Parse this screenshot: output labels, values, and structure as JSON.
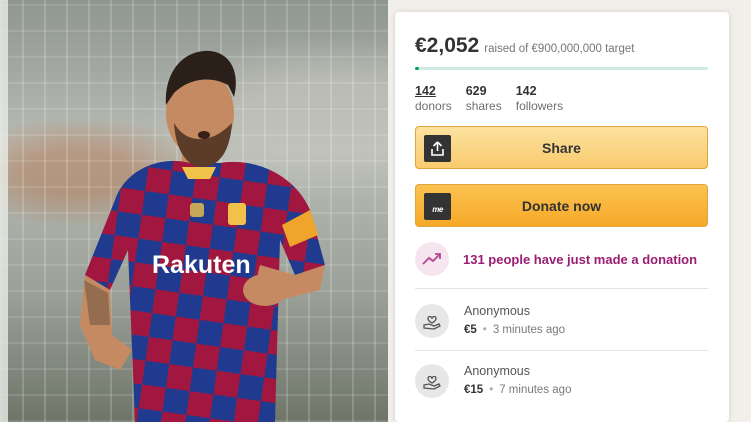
{
  "photo": {
    "alt": "Football player in a red and blue striped kit",
    "sponsor_text": "Rakuten"
  },
  "fundraiser": {
    "raised": "€2,052",
    "target_caption": "raised of €900,000,000 target",
    "progress_fraction": 0.002,
    "stats": [
      {
        "value": "142",
        "label": "donors"
      },
      {
        "value": "629",
        "label": "shares"
      },
      {
        "value": "142",
        "label": "followers"
      }
    ]
  },
  "buttons": {
    "share_label": "Share",
    "donate_label": "Donate now",
    "donate_icon_text": "me"
  },
  "activity": {
    "text": "131 people have just made a donation"
  },
  "donations": [
    {
      "name": "Anonymous",
      "amount": "€5",
      "time": "3 minutes ago"
    },
    {
      "name": "Anonymous",
      "amount": "€15",
      "time": "7 minutes ago"
    }
  ],
  "colors": {
    "progress": "#02a95c",
    "share_button": "#f9cb6e",
    "donate_button": "#f6a928",
    "activity_text": "#9b1d73"
  },
  "icons": {
    "share": "share-upload-icon",
    "donate": "gofundme-logo-icon",
    "trend": "trending-up-icon",
    "donor": "donor-hand-heart-icon"
  }
}
